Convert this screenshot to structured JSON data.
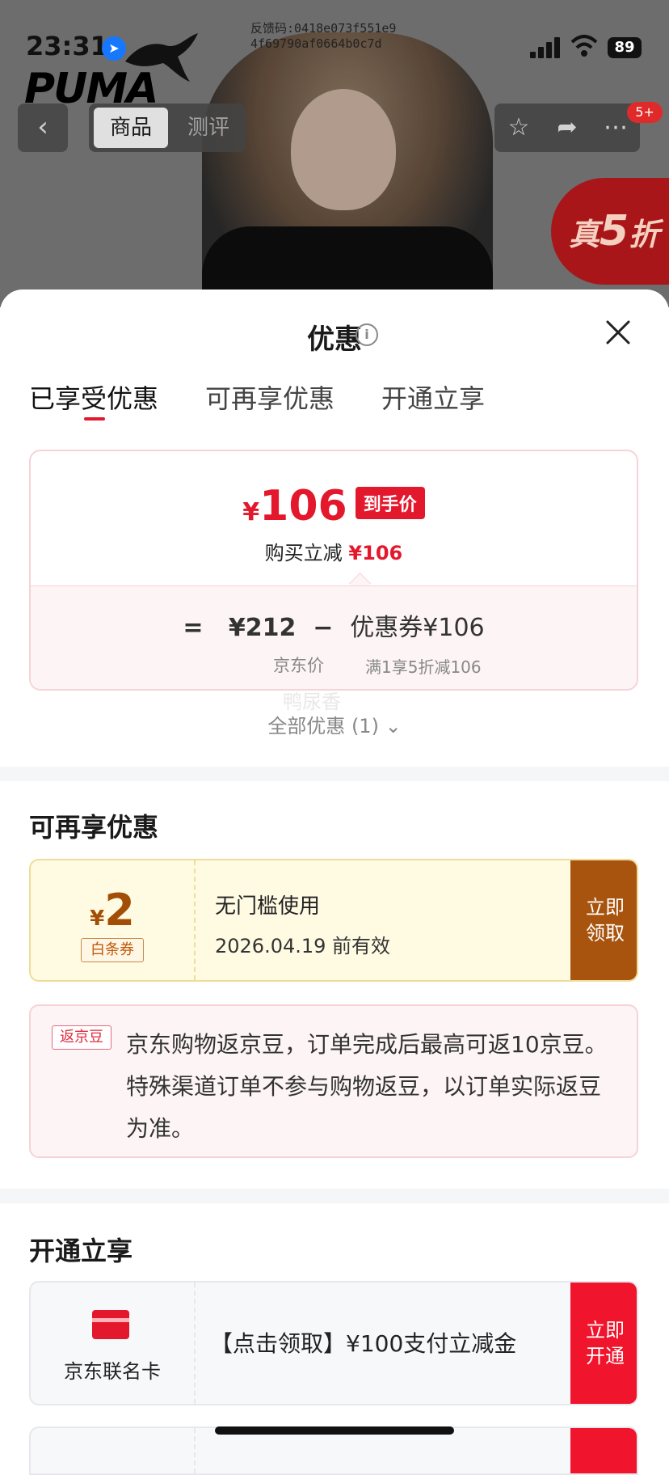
{
  "status_bar": {
    "time": "23:31",
    "feedback_line1": "反馈码:0418e073f551e9",
    "feedback_line2": "4f69790af0664b0c7d",
    "battery": "89"
  },
  "product_header": {
    "brand": "PUMA",
    "tabs": [
      "商品",
      "测评"
    ],
    "badge": "5+",
    "promo_prefix": "真",
    "promo_number": "5",
    "promo_suffix": "折"
  },
  "sheet": {
    "title": "优惠",
    "tabs": [
      "已享受优惠",
      "可再享优惠",
      "开通立享"
    ],
    "active_tab": 0
  },
  "enjoyed": {
    "currency": "¥",
    "final_price": "106",
    "final_price_tag": "到手价",
    "reduce_label": "购买立减",
    "reduce_amount": "¥106",
    "eq": "=",
    "jd_price": "¥212",
    "minus": "−",
    "coupon_label": "优惠券¥106",
    "jd_price_label": "京东价",
    "coupon_rule": "满1享5折减106",
    "watermark": "鸭尿香",
    "all_discounts": "全部优惠 (1)"
  },
  "more_discounts": {
    "title": "可再享优惠",
    "coupon": {
      "currency": "¥",
      "amount": "2",
      "type": "白条券",
      "condition": "无门槛使用",
      "valid_until": "2026.04.19 前有效",
      "button": "立即领取"
    },
    "bean": {
      "tag": "返京豆",
      "text": "京东购物返京豆，订单完成后最高可返10京豆。特殊渠道订单不参与购物返豆，以订单实际返豆为准。"
    }
  },
  "join": {
    "title": "开通立享",
    "card_name": "京东联名卡",
    "offer": "【点击领取】¥100支付立减金",
    "button": "立即开通"
  },
  "colors": {
    "accent_red": "#e4182d",
    "coupon_brown": "#a8540f",
    "coupon_bg": "#fffbe3"
  }
}
